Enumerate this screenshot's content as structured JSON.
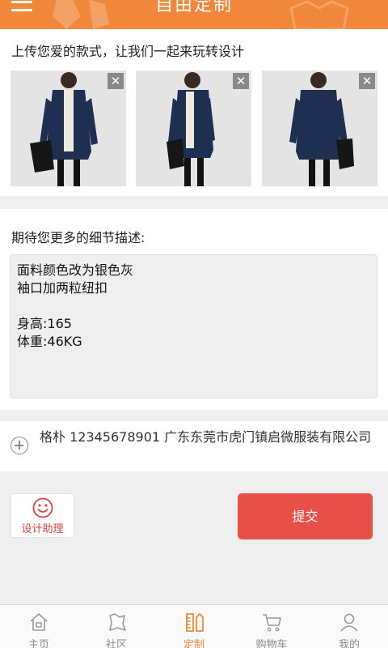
{
  "header": {
    "title": "自由定制",
    "menu_icon": "hamburger-icon"
  },
  "upload": {
    "prompt": "上传您爱的款式，让我们一起来玩转设计",
    "images": [
      {
        "alt": "coat-photo-front",
        "remove_label": "✕"
      },
      {
        "alt": "coat-photo-side",
        "remove_label": "✕"
      },
      {
        "alt": "coat-photo-back",
        "remove_label": "✕"
      }
    ]
  },
  "description": {
    "label": "期待您更多的细节描述:",
    "lines": [
      "面料颜色改为银色灰",
      "袖口加两粒纽扣",
      "",
      "身高:165",
      "体重:46KG"
    ]
  },
  "address": {
    "text": "格朴  12345678901  广东东莞市虎门镇启微服装有限公司"
  },
  "actions": {
    "helper_label": "设计助理",
    "submit_label": "提交"
  },
  "nav": {
    "items": [
      {
        "label": "主页",
        "icon": "home-icon",
        "active": false
      },
      {
        "label": "社区",
        "icon": "community-icon",
        "active": false
      },
      {
        "label": "定制",
        "icon": "ruler-icon",
        "active": true
      },
      {
        "label": "购物车",
        "icon": "cart-icon",
        "active": false
      },
      {
        "label": "我的",
        "icon": "user-icon",
        "active": false
      }
    ]
  },
  "colors": {
    "accent": "#f0873a",
    "submit": "#e8504a",
    "helper_text": "#e2413d"
  }
}
